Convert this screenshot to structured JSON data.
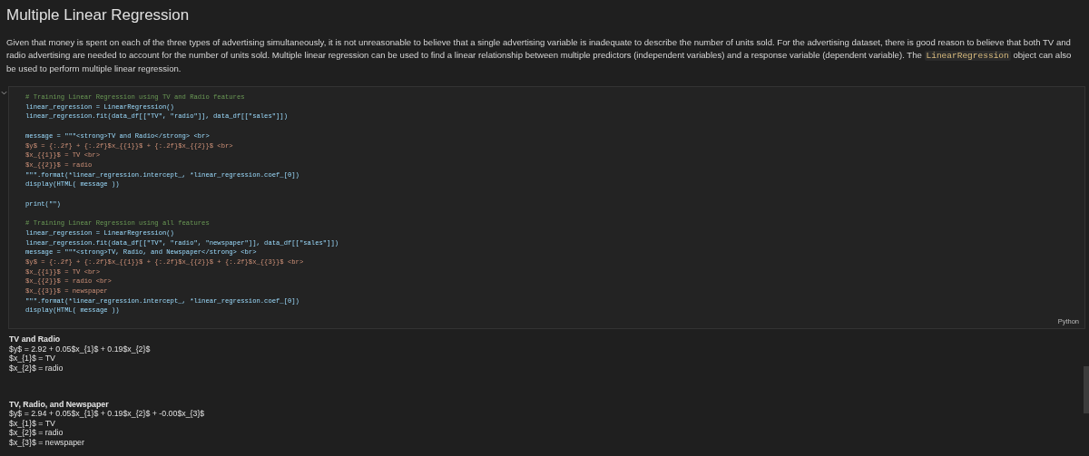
{
  "heading": "Multiple Linear Regression",
  "paragraph": {
    "before": "Given that money is spent on each of the three types of advertising simultaneously, it is not unreasonable to believe that a single advertising variable is inadequate to describe the number of units sold. For the advertising dataset, there is good reason to believe that both TV and radio advertising are needed to account for the number of units sold. Multiple linear regression can be used to find a linear relationship between multiple predictors (independent variables) and a response variable (dependent variable). The",
    "code": "LinearRegression",
    "after": "object can also be used to perform multiple linear regression."
  },
  "code_cell": {
    "expanded": true,
    "language": "Python",
    "lines": [
      {
        "kind": "comment",
        "text": "# Training Linear Regression using TV and Radio features"
      },
      {
        "kind": "code",
        "text": "linear_regression = LinearRegression()"
      },
      {
        "kind": "code",
        "text": "linear_regression.fit(data_df[[\"TV\", \"radio\"]], data_df[[\"sales\"]])"
      },
      {
        "kind": "blank"
      },
      {
        "kind": "code",
        "text": "message = \"\"\"<strong>TV and Radio</strong> <br>"
      },
      {
        "kind": "string",
        "text": "$y$ = {:.2f} + {:.2f}$x_{{1}}$ + {:.2f}$x_{{2}}$ <br>"
      },
      {
        "kind": "string",
        "text": "$x_{{1}}$ = TV <br>"
      },
      {
        "kind": "string",
        "text": "$x_{{2}}$ = radio"
      },
      {
        "kind": "code",
        "text": "\"\"\".format(*linear_regression.intercept_, *linear_regression.coef_[0])"
      },
      {
        "kind": "code",
        "text": "display(HTML( message ))"
      },
      {
        "kind": "blank"
      },
      {
        "kind": "code",
        "text": "print(\"\")"
      },
      {
        "kind": "blank"
      },
      {
        "kind": "comment",
        "text": "# Training Linear Regression using all features"
      },
      {
        "kind": "code",
        "text": "linear_regression = LinearRegression()"
      },
      {
        "kind": "code",
        "text": "linear_regression.fit(data_df[[\"TV\", \"radio\", \"newspaper\"]], data_df[[\"sales\"]])"
      },
      {
        "kind": "code",
        "text": "message = \"\"\"<strong>TV, Radio, and Newspaper</strong> <br>"
      },
      {
        "kind": "string",
        "text": "$y$ = {:.2f} + {:.2f}$x_{{1}}$ + {:.2f}$x_{{2}}$ + {:.2f}$x_{{3}}$ <br>"
      },
      {
        "kind": "string",
        "text": "$x_{{1}}$ = TV <br>"
      },
      {
        "kind": "string",
        "text": "$x_{{2}}$ = radio <br>"
      },
      {
        "kind": "string",
        "text": "$x_{{3}}$ = newspaper"
      },
      {
        "kind": "code",
        "text": "\"\"\".format(*linear_regression.intercept_, *linear_regression.coef_[0])"
      },
      {
        "kind": "code",
        "text": "display(HTML( message ))"
      }
    ]
  },
  "outputs": [
    {
      "title": "TV and Radio",
      "lines": [
        "$y$ = 2.92 + 0.05$x_{1}$ + 0.19$x_{2}$",
        "$x_{1}$ = TV",
        "$x_{2}$ = radio"
      ]
    },
    {
      "title": "TV, Radio, and Newspaper",
      "lines": [
        "$y$ = 2.94 + 0.05$x_{1}$ + 0.19$x_{2}$ + -0.00$x_{3}$",
        "$x_{1}$ = TV",
        "$x_{2}$ = radio",
        "$x_{3}$ = newspaper"
      ]
    }
  ]
}
